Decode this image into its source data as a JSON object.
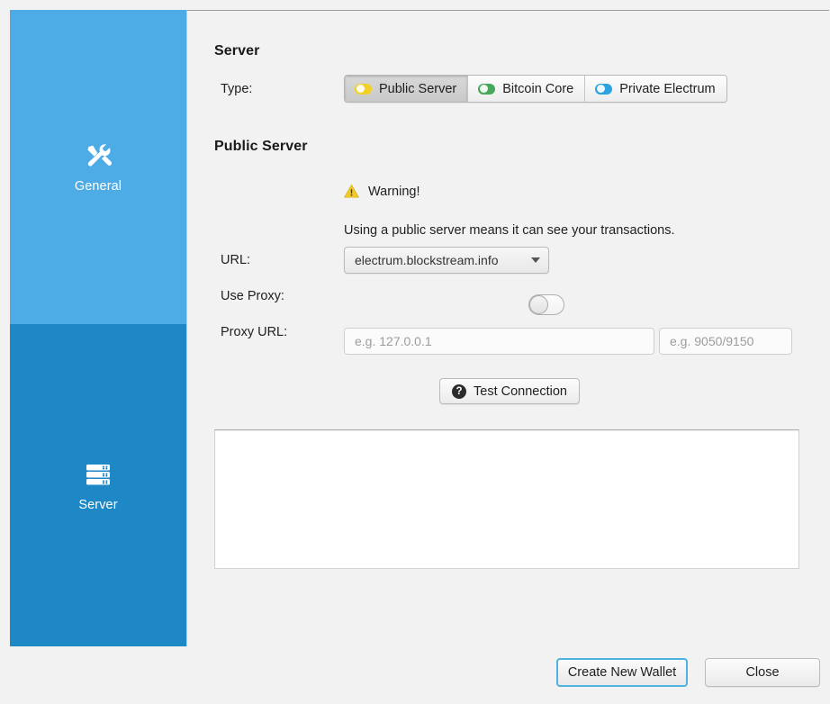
{
  "sidebar": {
    "items": [
      {
        "id": "general",
        "label": "General",
        "icon": "tools-icon",
        "color": "#4dabe6",
        "selected": false
      },
      {
        "id": "server",
        "label": "Server",
        "icon": "server-rack-icon",
        "color": "#1e88c7",
        "selected": true
      }
    ]
  },
  "server_section": {
    "title": "Server",
    "type_label": "Type:",
    "type_options": [
      {
        "label": "Public Server",
        "indicator_color": "#f2d127",
        "selected": true
      },
      {
        "label": "Bitcoin Core",
        "indicator_color": "#46a85a",
        "selected": false
      },
      {
        "label": "Private Electrum",
        "indicator_color": "#2ba3e0",
        "selected": false
      }
    ]
  },
  "public_server": {
    "title": "Public Server",
    "warning_label": "Warning!",
    "warning_icon": "warning-triangle-icon",
    "warning_color": "#f2c829",
    "warning_description": "Using a public server means it can see your transactions.",
    "url_label": "URL:",
    "url_value": "electrum.blockstream.info",
    "use_proxy_label": "Use Proxy:",
    "use_proxy_enabled": false,
    "proxy_url_label": "Proxy URL:",
    "proxy_host_placeholder": "e.g. 127.0.0.1",
    "proxy_host_value": "",
    "proxy_port_placeholder": "e.g. 9050/9150",
    "proxy_port_value": "",
    "test_connection_label": "Test Connection",
    "test_connection_icon": "help-circle-icon",
    "log_output": ""
  },
  "footer": {
    "create_wallet_label": "Create New Wallet",
    "close_label": "Close",
    "focus_color": "#4fb3e0"
  }
}
